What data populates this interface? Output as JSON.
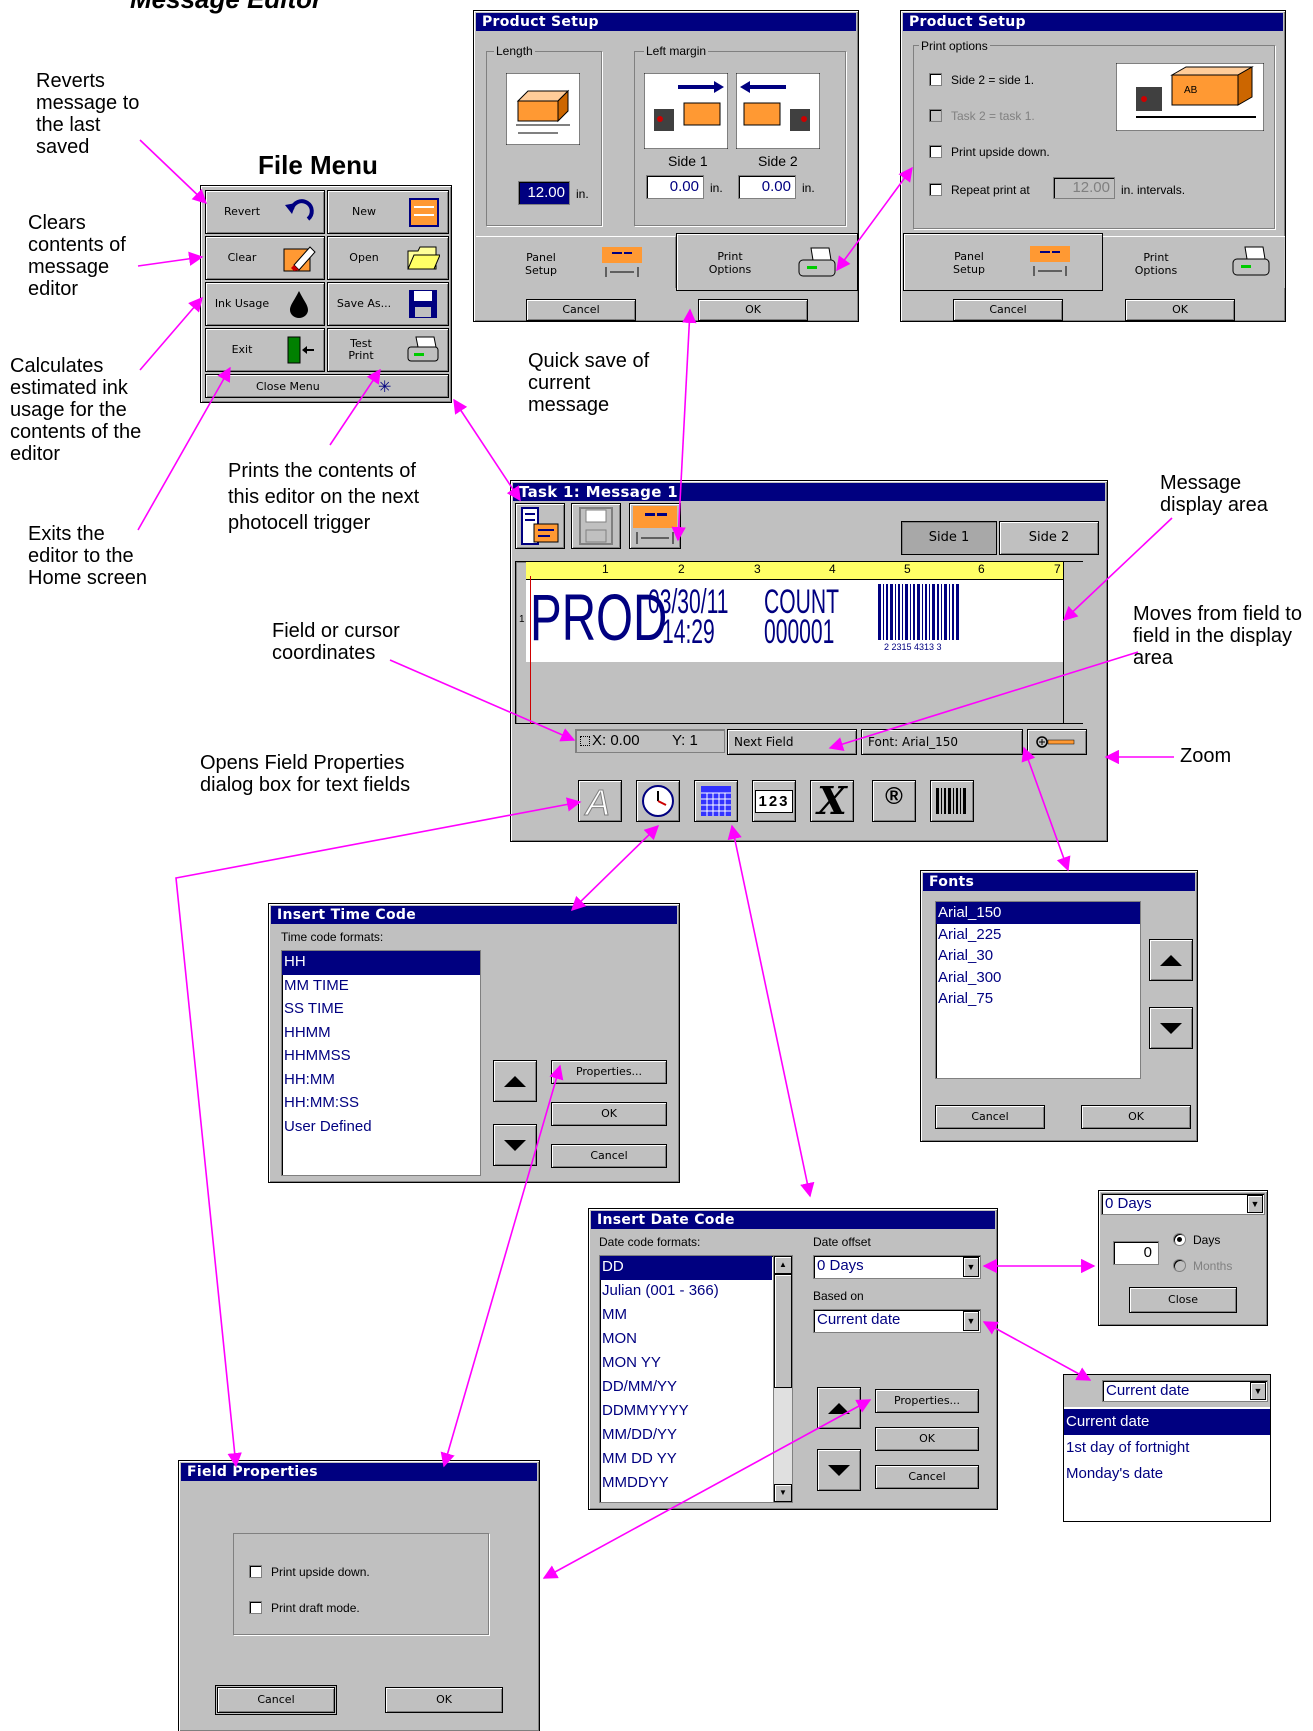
{
  "heading": {
    "file_menu": "File Menu",
    "message_editor_partial": "Message Editor"
  },
  "callouts": {
    "revert": "Reverts message to the last saved",
    "clear": "Clears contents of message editor",
    "ink": "Calculates estimated ink usage for the contents of the editor",
    "exit": "Exits the editor to the Home screen",
    "test_print": "Prints the contents of this editor on the next photocell trigger",
    "quick_save": "Quick save of current message",
    "display_area": "Message display area",
    "next_field": "Moves from field to field in the display area",
    "coords": "Field or cursor coordinates",
    "field_props": "Opens Field Properties dialog box for text fields",
    "zoom": "Zoom"
  },
  "file_menu": {
    "buttons": [
      {
        "label": "Revert",
        "icon": "undo-icon"
      },
      {
        "label": "New",
        "icon": "new-document-icon"
      },
      {
        "label": "Clear",
        "icon": "eraser-icon"
      },
      {
        "label": "Open",
        "icon": "folder-icon"
      },
      {
        "label": "Ink Usage",
        "icon": "ink-drop-icon"
      },
      {
        "label": "Save As...",
        "icon": "floppy-disk-icon"
      },
      {
        "label": "Exit",
        "icon": "exit-door-icon"
      },
      {
        "label": "Test Print",
        "icon": "printer-icon"
      }
    ],
    "close_label": "Close Menu"
  },
  "product_setup_1": {
    "title": "Product Setup",
    "length_label": "Length",
    "left_margin_label": "Left margin",
    "length_value": "12.00",
    "unit": "in.",
    "side1_label": "Side 1",
    "side2_label": "Side 2",
    "side1_value": "0.00",
    "side2_value": "0.00",
    "tab_panel": "Panel Setup",
    "tab_print": "Print Options",
    "cancel": "Cancel",
    "ok": "OK"
  },
  "product_setup_2": {
    "title": "Product Setup",
    "group_label": "Print options",
    "opt1": "Side 2 = side 1.",
    "opt2": "Task 2 = task 1.",
    "opt3": "Print upside down.",
    "opt4_prefix": "Repeat print at",
    "opt4_value": "12.00",
    "opt4_suffix": "in. intervals.",
    "preview_text": "AB",
    "tab_panel": "Panel Setup",
    "tab_print": "Print Options",
    "cancel": "Cancel",
    "ok": "OK"
  },
  "editor": {
    "title": "Task 1: Message 1",
    "side1": "Side 1",
    "side2": "Side 2",
    "ruler_numbers": [
      "1",
      "2",
      "3",
      "4",
      "5",
      "6",
      "7"
    ],
    "row_number": "1",
    "message": {
      "prod": "PROD",
      "date": "03/30/11",
      "time": "14:29",
      "count_label": "COUNT",
      "count_value": "000001",
      "barcode_digits": "2 2315 4313 3"
    },
    "coords_x": "X: 0.00",
    "coords_y": "Y: 1",
    "next_field": "Next Field",
    "font": "Font: Arial_150",
    "tools": [
      "text-tool-icon",
      "clock-icon",
      "calendar-icon",
      "counter-icon",
      "variable-icon",
      "registered-icon",
      "barcode-icon"
    ],
    "counter_glyph": "123",
    "registered_glyph": "®",
    "variable_glyph": "X"
  },
  "fonts_dialog": {
    "title": "Fonts",
    "items": [
      "Arial_150",
      "Arial_225",
      "Arial_30",
      "Arial_300",
      "Arial_75"
    ],
    "selected": 0,
    "cancel": "Cancel",
    "ok": "OK"
  },
  "time_code": {
    "title": "Insert Time Code",
    "label": "Time code formats:",
    "items": [
      "HH",
      "MM TIME",
      "SS TIME",
      "HHMM",
      "HHMMSS",
      "HH:MM",
      "HH:MM:SS",
      "User Defined"
    ],
    "selected": 0,
    "properties": "Properties...",
    "ok": "OK",
    "cancel": "Cancel"
  },
  "date_code": {
    "title": "Insert Date Code",
    "label": "Date code formats:",
    "items": [
      "DD",
      "Julian (001 - 366)",
      "MM",
      "MON",
      "MON YY",
      "DD/MM/YY",
      "DDMMYYYY",
      "MM/DD/YY",
      "MM DD YY",
      "MMDDYY"
    ],
    "selected": 0,
    "offset_label": "Date offset",
    "offset_value": "0 Days",
    "based_label": "Based on",
    "based_value": "Current date",
    "properties": "Properties...",
    "ok": "OK",
    "cancel": "Cancel"
  },
  "offset_popup": {
    "combo_value": "0 Days",
    "number": "0",
    "days": "Days",
    "months": "Months",
    "close": "Close"
  },
  "based_popup": {
    "combo_value": "Current date",
    "items": [
      "Current date",
      "1st day of fortnight",
      "Monday's date"
    ],
    "selected": 0
  },
  "field_properties": {
    "title": "Field Properties",
    "opt1": "Print upside down.",
    "opt2": "Print draft mode.",
    "cancel": "Cancel",
    "ok": "OK"
  },
  "colors": {
    "title_bar": "#000080",
    "dialog": "#c0c0c0",
    "callout_arrow": "#ff00ff",
    "accent_orange": "#ff9933",
    "ruler": "#ffff66"
  }
}
